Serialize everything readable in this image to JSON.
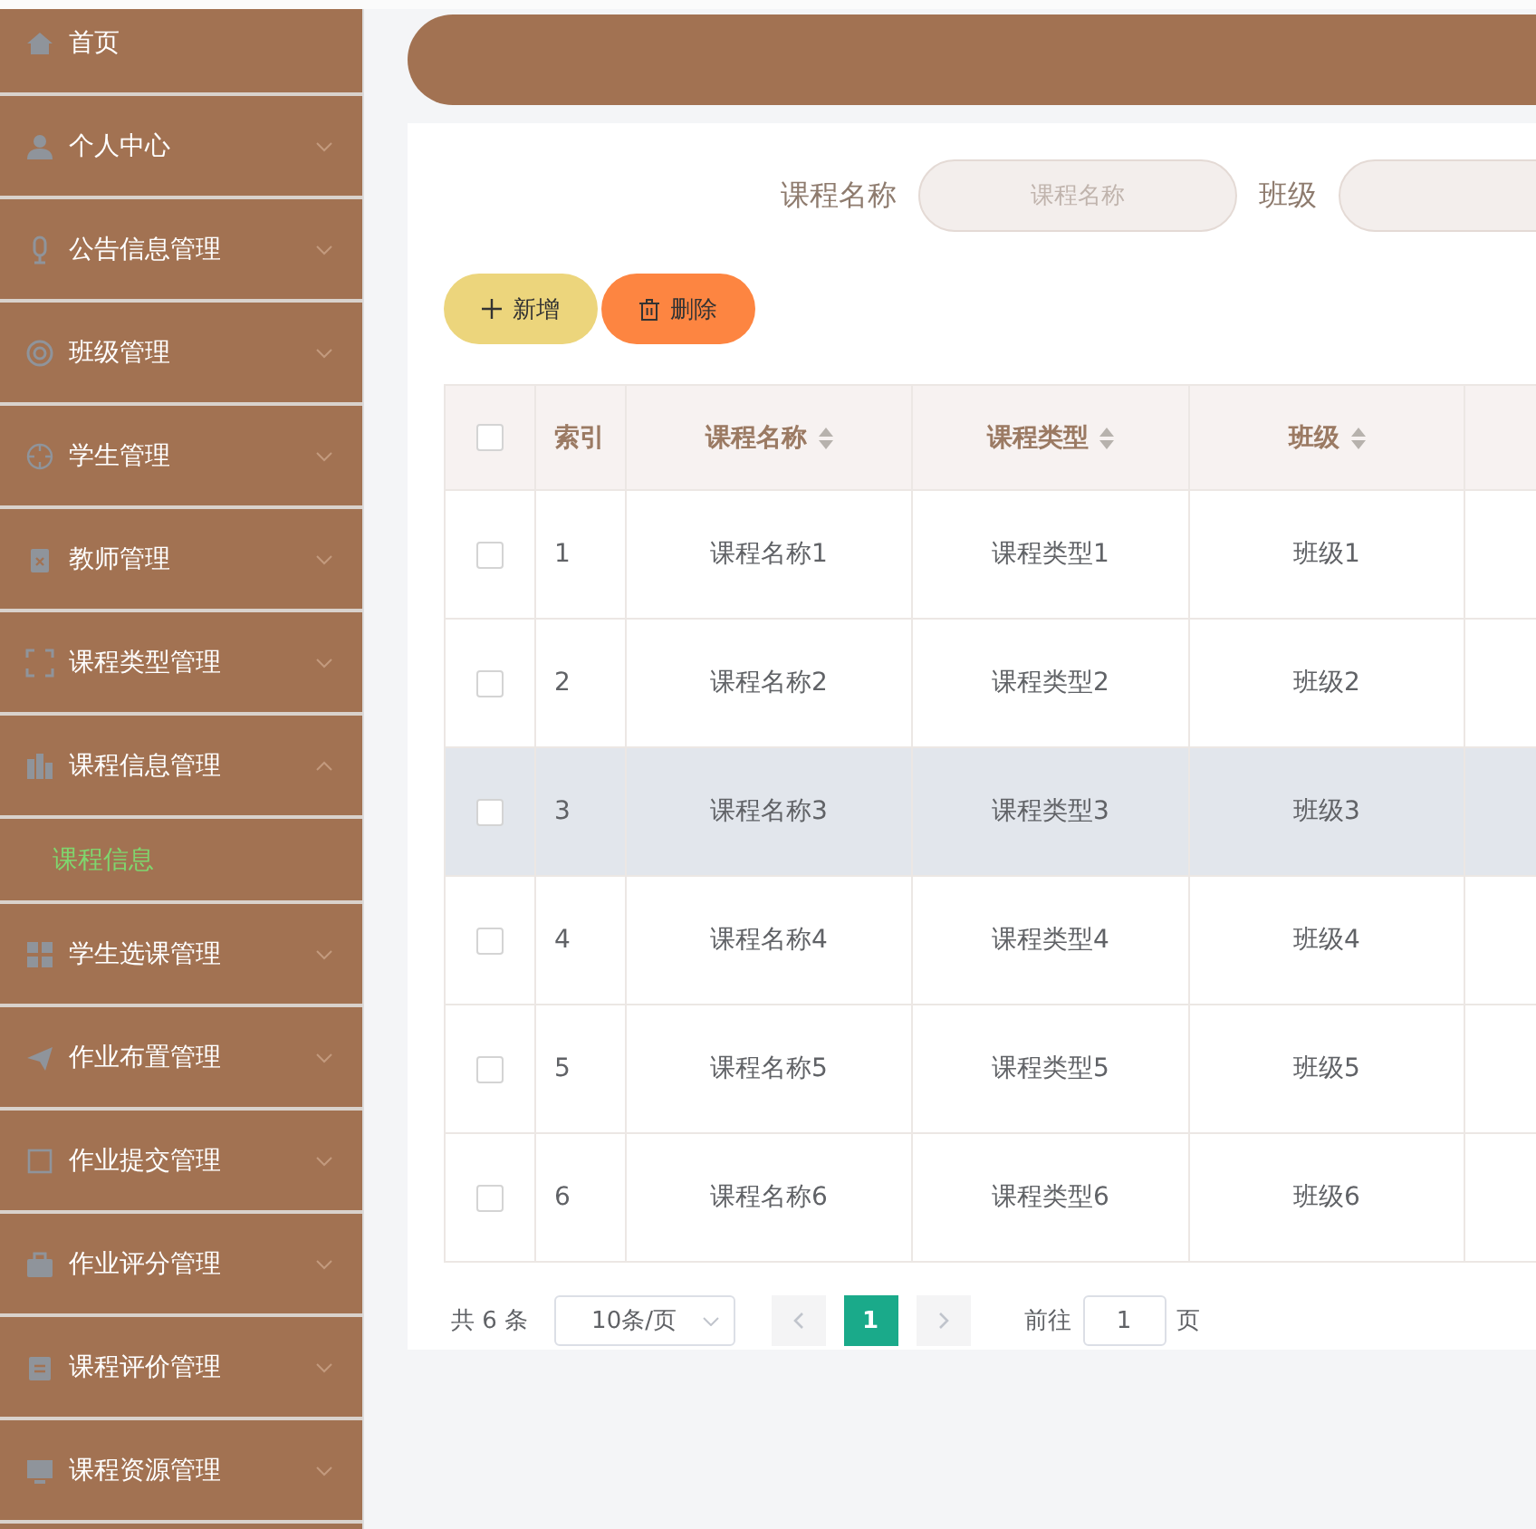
{
  "sidebar": {
    "items": [
      {
        "label": "首页",
        "kind": "link"
      },
      {
        "label": "个人中心",
        "kind": "submenu",
        "expanded": false
      },
      {
        "label": "公告信息管理",
        "kind": "submenu",
        "expanded": false
      },
      {
        "label": "班级管理",
        "kind": "submenu",
        "expanded": false
      },
      {
        "label": "学生管理",
        "kind": "submenu",
        "expanded": false
      },
      {
        "label": "教师管理",
        "kind": "submenu",
        "expanded": false
      },
      {
        "label": "课程类型管理",
        "kind": "submenu",
        "expanded": false
      },
      {
        "label": "课程信息管理",
        "kind": "submenu",
        "expanded": true,
        "children": [
          {
            "label": "课程信息",
            "selected": true
          }
        ]
      },
      {
        "label": "学生选课管理",
        "kind": "submenu",
        "expanded": false
      },
      {
        "label": "作业布置管理",
        "kind": "submenu",
        "expanded": false
      },
      {
        "label": "作业提交管理",
        "kind": "submenu",
        "expanded": false
      },
      {
        "label": "作业评分管理",
        "kind": "submenu",
        "expanded": false
      },
      {
        "label": "课程评价管理",
        "kind": "submenu",
        "expanded": false
      },
      {
        "label": "课程资源管理",
        "kind": "submenu",
        "expanded": false
      }
    ]
  },
  "search": {
    "fields": [
      {
        "label": "课程名称",
        "placeholder": "课程名称"
      },
      {
        "label": "班级"
      }
    ]
  },
  "buttons": [
    {
      "label": "新增",
      "kind": "add"
    },
    {
      "label": "删除",
      "kind": "delete"
    }
  ],
  "table": {
    "select_all": {
      "checked": false
    },
    "columns": [
      {
        "label": "索引",
        "sortable": false
      },
      {
        "label": "课程名称",
        "sortable": true
      },
      {
        "label": "课程类型",
        "sortable": true
      },
      {
        "label": "班级",
        "sortable": true
      }
    ],
    "rows": [
      {
        "checked": false,
        "highlighted": false,
        "cells": [
          "1",
          "课程名称1",
          "课程类型1",
          "班级1"
        ]
      },
      {
        "checked": false,
        "highlighted": false,
        "cells": [
          "2",
          "课程名称2",
          "课程类型2",
          "班级2"
        ]
      },
      {
        "checked": false,
        "highlighted": true,
        "cells": [
          "3",
          "课程名称3",
          "课程类型3",
          "班级3"
        ]
      },
      {
        "checked": false,
        "highlighted": false,
        "cells": [
          "4",
          "课程名称4",
          "课程类型4",
          "班级4"
        ]
      },
      {
        "checked": false,
        "highlighted": false,
        "cells": [
          "5",
          "课程名称5",
          "课程类型5",
          "班级5"
        ]
      },
      {
        "checked": false,
        "highlighted": false,
        "cells": [
          "6",
          "课程名称6",
          "课程类型6",
          "班级6"
        ]
      }
    ]
  },
  "pagination": {
    "total": "共 6 条",
    "page_size": "10条/页",
    "pages": [
      {
        "label": "1",
        "selected": true
      }
    ],
    "goto_label": "前往",
    "goto_value": "1",
    "goto_suffix": "页"
  }
}
